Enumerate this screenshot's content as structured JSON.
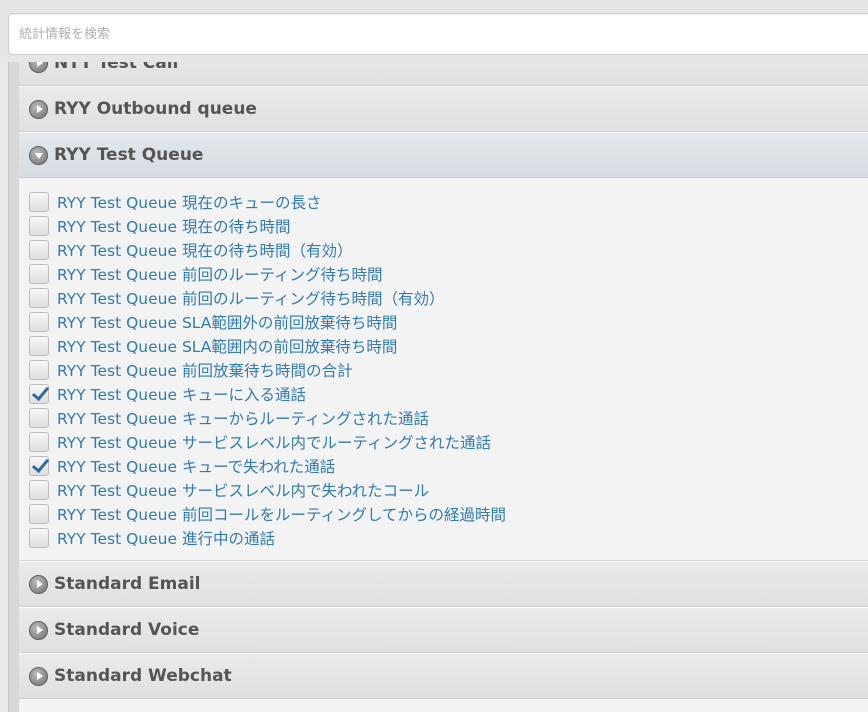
{
  "search": {
    "placeholder": "統計情報を検索"
  },
  "queues_before": [
    {
      "title": "NTT Test Call"
    },
    {
      "title": "RYY Outbound queue"
    }
  ],
  "active_queue": {
    "title": "RYY Test Queue",
    "metrics": [
      {
        "label": "RYY Test Queue 現在のキューの長さ",
        "checked": false
      },
      {
        "label": "RYY Test Queue 現在の待ち時間",
        "checked": false
      },
      {
        "label": "RYY Test Queue 現在の待ち時間（有効）",
        "checked": false
      },
      {
        "label": "RYY Test Queue 前回のルーティング待ち時間",
        "checked": false
      },
      {
        "label": "RYY Test Queue 前回のルーティング待ち時間（有効）",
        "checked": false
      },
      {
        "label": "RYY Test Queue SLA範囲外の前回放棄待ち時間",
        "checked": false
      },
      {
        "label": "RYY Test Queue SLA範囲内の前回放棄待ち時間",
        "checked": false
      },
      {
        "label": "RYY Test Queue 前回放棄待ち時間の合計",
        "checked": false
      },
      {
        "label": "RYY Test Queue キューに入る通話",
        "checked": true
      },
      {
        "label": "RYY Test Queue キューからルーティングされた通話",
        "checked": false
      },
      {
        "label": "RYY Test Queue サービスレベル内でルーティングされた通話",
        "checked": false
      },
      {
        "label": "RYY Test Queue キューで失われた通話",
        "checked": true
      },
      {
        "label": "RYY Test Queue サービスレベル内で失われたコール",
        "checked": false
      },
      {
        "label": "RYY Test Queue 前回コールをルーティングしてからの経過時間",
        "checked": false
      },
      {
        "label": "RYY Test Queue 進行中の通話",
        "checked": false
      }
    ]
  },
  "queues_after": [
    {
      "title": "Standard Email"
    },
    {
      "title": "Standard Voice"
    },
    {
      "title": "Standard Webchat"
    }
  ],
  "colors": {
    "link": "#2f7ab8",
    "check": "#2c6aa0"
  }
}
